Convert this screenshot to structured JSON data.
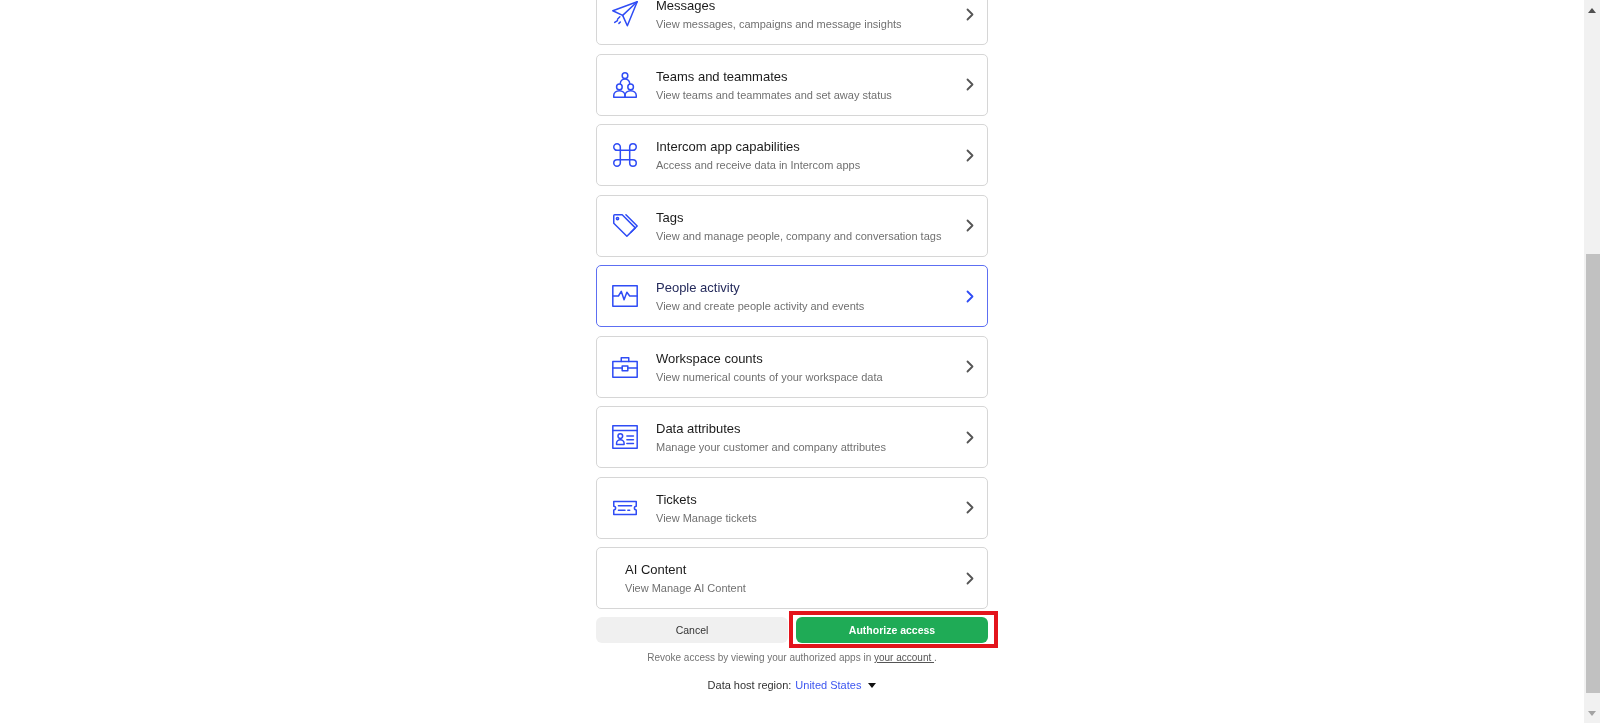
{
  "permissions": [
    {
      "title": "Messages",
      "description": "View messages, campaigns and message insights",
      "kind": "icon",
      "selected": false
    },
    {
      "title": "Teams and teammates",
      "description": "View teams and teammates and set away status",
      "kind": "icon",
      "selected": false
    },
    {
      "title": "Intercom app capabilities",
      "description": "Access and receive data in Intercom apps",
      "kind": "icon",
      "selected": false
    },
    {
      "title": "Tags",
      "description": "View and manage people, company and conversation tags",
      "kind": "icon",
      "selected": false
    },
    {
      "title": "People activity",
      "description": "View and create people activity and events",
      "kind": "icon",
      "selected": true
    },
    {
      "title": "Workspace counts",
      "description": "View numerical counts of your workspace data",
      "kind": "icon",
      "selected": false
    },
    {
      "title": "Data attributes",
      "description": "Manage your customer and company attributes",
      "kind": "icon",
      "selected": false
    },
    {
      "title": "Tickets",
      "description": "View Manage tickets",
      "kind": "icon",
      "selected": false
    },
    {
      "title": "AI Content",
      "description": "View Manage AI Content",
      "kind": "text",
      "selected": false
    }
  ],
  "buttons": [
    {
      "label": "Cancel",
      "kind": "secondary",
      "highlighted": false
    },
    {
      "label": "Authorize access",
      "kind": "primary",
      "highlighted": true
    }
  ],
  "revoke_note": {
    "text": "Revoke access by viewing your authorized apps in",
    "link": "your account",
    "end": "."
  },
  "region": {
    "label": "Data host region:",
    "value": "United States"
  }
}
